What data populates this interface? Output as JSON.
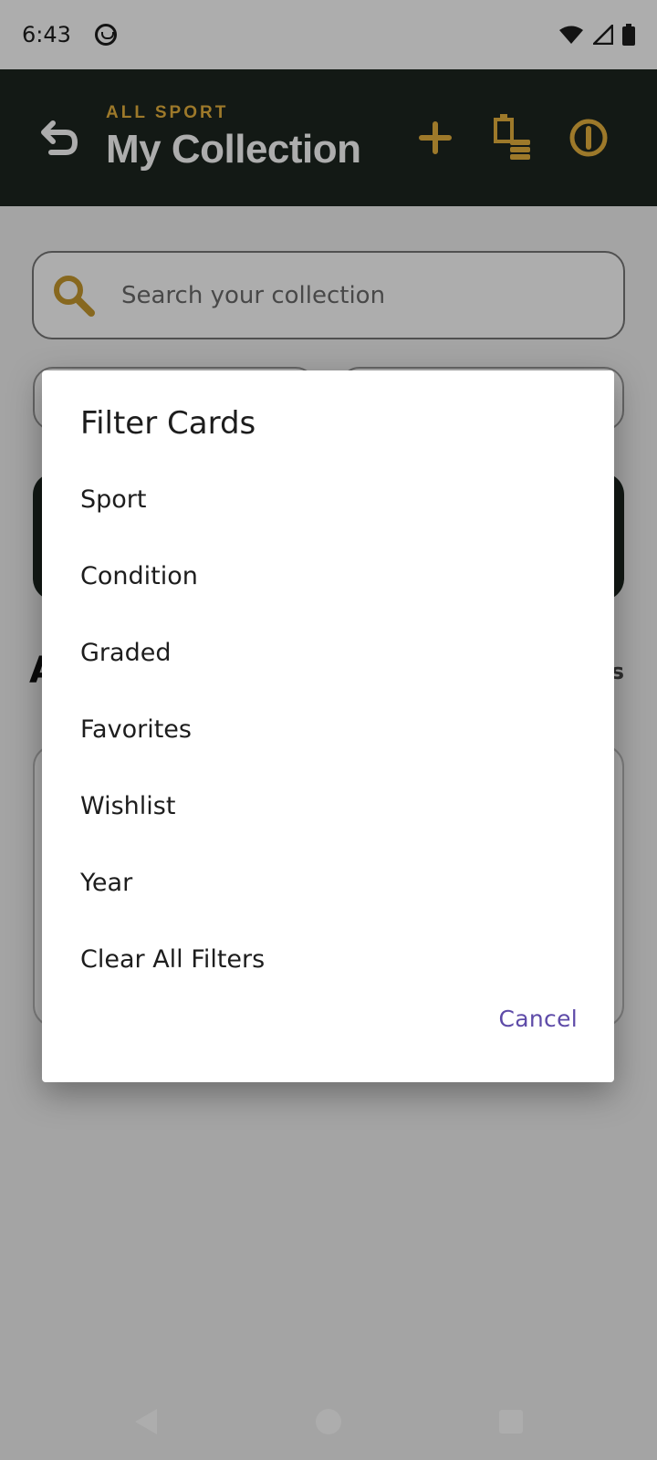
{
  "status_bar": {
    "time": "6:43"
  },
  "app_bar": {
    "subtitle": "ALL SPORT",
    "title": "My Collection",
    "accent_color": "#e8b33e",
    "background_color": "#1c261f"
  },
  "search": {
    "placeholder": "Search your collection"
  },
  "background": {
    "section_heading_stub": "A",
    "section_count_stub": "s"
  },
  "dialog": {
    "title": "Filter Cards",
    "items": [
      "Sport",
      "Condition",
      "Graded",
      "Favorites",
      "Wishlist",
      "Year",
      "Clear All Filters"
    ],
    "cancel_label": "Cancel",
    "cancel_color": "#5e4ba8"
  }
}
